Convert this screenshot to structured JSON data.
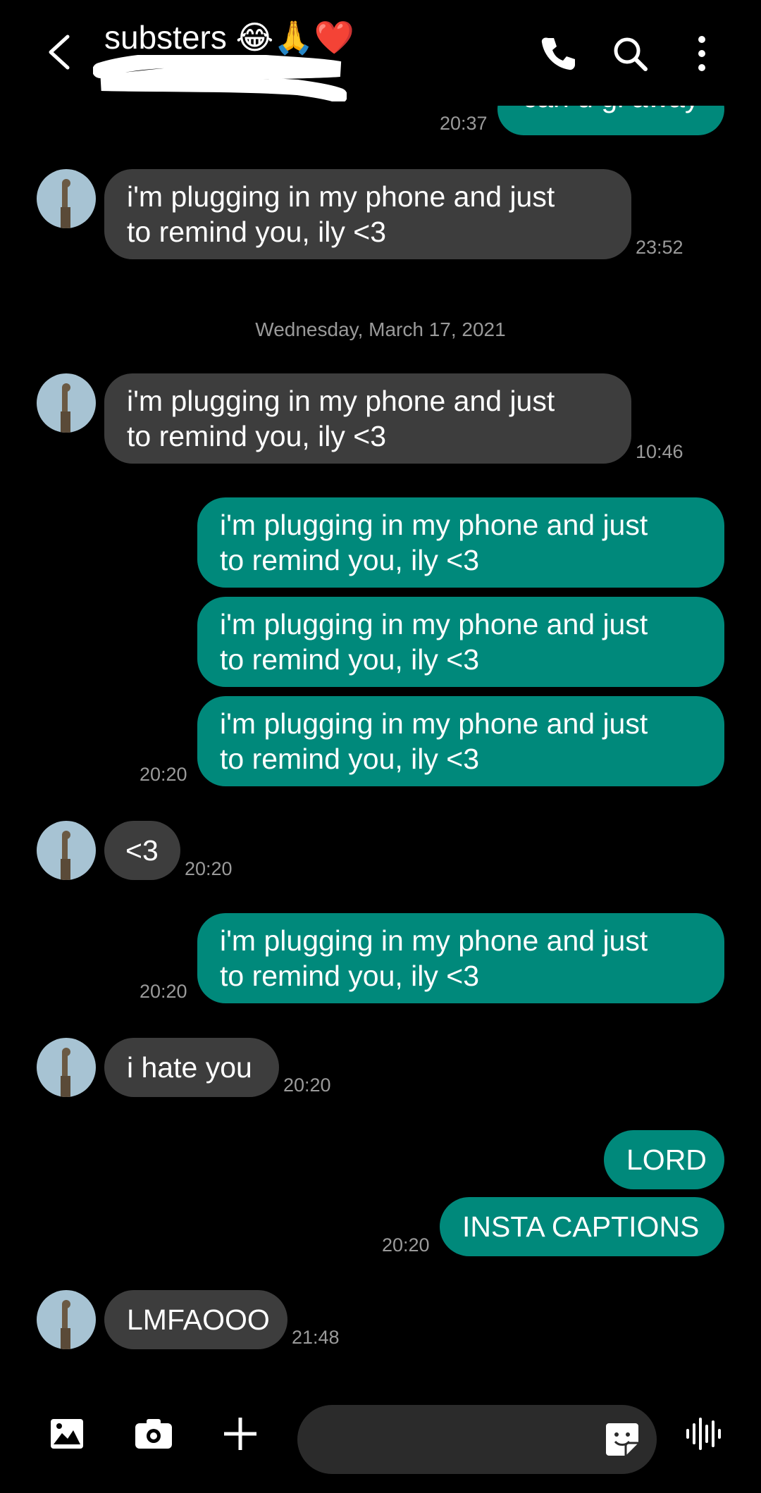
{
  "header": {
    "title": "substers 😂🙏❤️"
  },
  "messages": [
    {
      "text": "can u gi away",
      "time": "20:37"
    },
    {
      "text": "i'm plugging in my phone and just\nto remind you, ily <3",
      "time": "23:52"
    },
    {
      "date": "Wednesday, March 17, 2021"
    },
    {
      "text": "i'm plugging in my phone and just\nto remind you, ily <3",
      "time": "10:46"
    },
    {
      "text": "i'm plugging in my phone and just\nto remind you, ily <3"
    },
    {
      "text": "i'm plugging in my phone and just\nto remind you, ily <3"
    },
    {
      "text": "i'm plugging in my phone and just\nto remind you, ily <3",
      "time": "20:20"
    },
    {
      "text": "<3",
      "time": "20:20"
    },
    {
      "text": "i'm plugging in my phone and just\nto remind you, ily <3",
      "time": "20:20"
    },
    {
      "text": "i hate you",
      "time": "20:20"
    },
    {
      "text": "LORD"
    },
    {
      "text": "INSTA CAPTIONS",
      "time": "20:20"
    },
    {
      "text": "LMFAOOO",
      "time": "21:48"
    }
  ],
  "icons": {
    "back": "back-arrow-icon",
    "call": "phone-icon",
    "search": "search-icon",
    "menu": "more-vert-icon",
    "gallery": "image-icon",
    "camera": "camera-icon",
    "add": "plus-icon",
    "sticker": "sticker-icon",
    "voice": "voice-wave-icon"
  },
  "colors": {
    "incoming_bubble": "#3d3d3d",
    "outgoing_bubble": "#00897b",
    "background": "#000000"
  }
}
